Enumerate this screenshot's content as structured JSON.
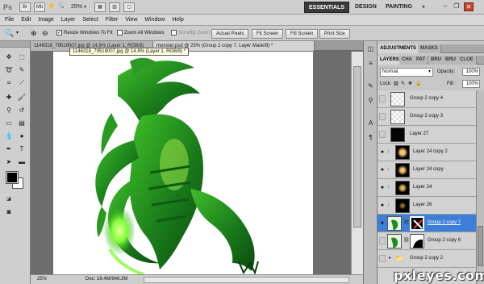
{
  "titlebar": {
    "logo": "Ps",
    "zoom_level": "25%",
    "workspaces": [
      "ESSENTIALS",
      "DESIGN",
      "PAINTING"
    ],
    "more": "»"
  },
  "menu": [
    "File",
    "Edit",
    "Image",
    "Layer",
    "Select",
    "Filter",
    "View",
    "Window",
    "Help"
  ],
  "options": {
    "resize_windows": "Resize Windows To Fit",
    "zoom_all_windows": "Zoom All Windows",
    "scrubby_zoom": "Scrubby Zoom",
    "buttons": [
      "Actual Pixels",
      "Fit Screen",
      "Fill Screen",
      "Print Size"
    ]
  },
  "document": {
    "tabs": [
      "1146318_79518007.jpg @ 14.8% (Layer 1, RGB/8)",
      "monster.psd @ 25% (Group 2 copy 7, Layer Mask/8) *"
    ],
    "tooltip": "1146318_79518007.jpg @ 14.8% (Layer 1, RGB/8) *"
  },
  "status": {
    "zoom": "25%",
    "doc": "Doc: 16.4M/946.3M"
  },
  "panels": {
    "top_tabs": [
      "ADJUSTMENTS",
      "MASKS"
    ],
    "layer_tabs": [
      "LAYERS",
      "CHA",
      "PAT",
      "BRU",
      "BRU",
      "CLOE"
    ],
    "blend_mode": "Normal",
    "opacity_label": "Opacity:",
    "opacity_value": "100%",
    "lock_label": "Lock:",
    "fill_label": "Fill:",
    "fill_value": "100%",
    "layers": [
      {
        "name": "Group 2 copy 4",
        "visible": false,
        "thumb": "checker"
      },
      {
        "name": "Group 2 copy 3",
        "visible": false,
        "thumb": "checker"
      },
      {
        "name": "Layer 27",
        "visible": false,
        "thumb": "dark"
      },
      {
        "name": "Layer 24 copy 2",
        "visible": true,
        "thumb": "glow"
      },
      {
        "name": "Layer 24 copy",
        "visible": true,
        "thumb": "glow"
      },
      {
        "name": "Layer 24",
        "visible": true,
        "thumb": "glow"
      },
      {
        "name": "Layer 26",
        "visible": true,
        "thumb": "dark"
      },
      {
        "name": "Group 2 copy 7",
        "visible": true,
        "thumb": "monster",
        "selected": true
      },
      {
        "name": "Group 2 copy 6",
        "visible": false,
        "thumb": "monster"
      },
      {
        "name": "Group 2 copy 2",
        "visible": false,
        "thumb": "folder"
      }
    ]
  },
  "watermark": "pxleyes.com",
  "colors": {
    "accent": "#3d7ed8",
    "creature_green": "#1f8a1f",
    "glow_green": "#7fff3a"
  }
}
